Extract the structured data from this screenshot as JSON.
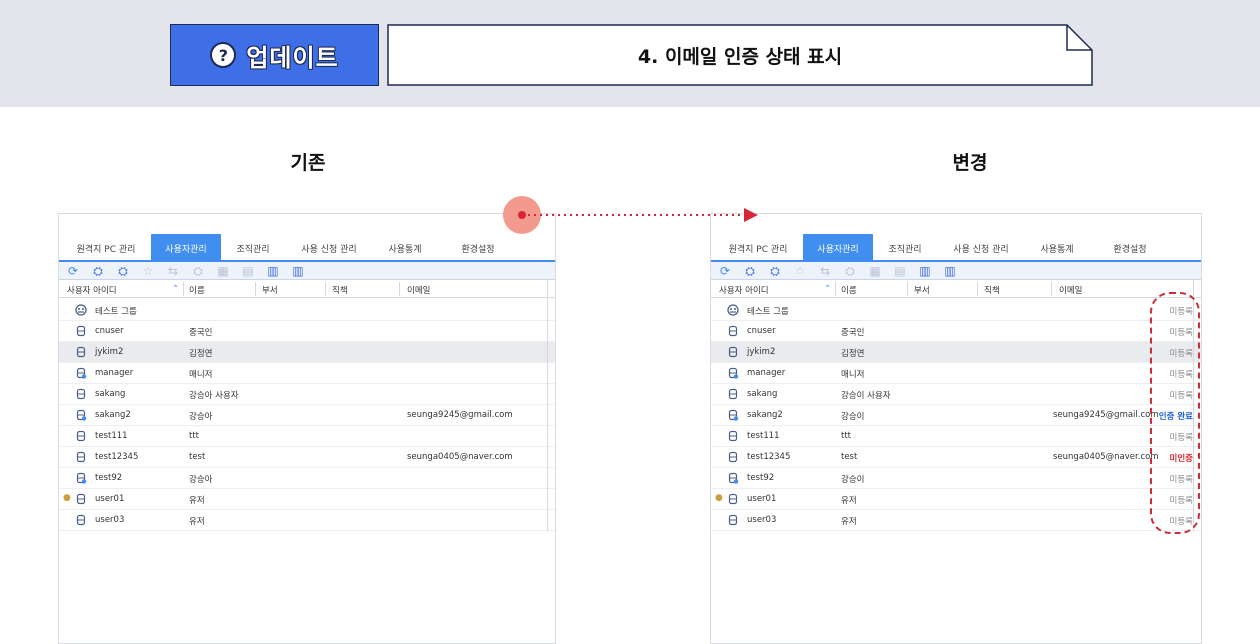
{
  "banner": {
    "badge_label": "업데이트",
    "badge_icon": "question-chat-icon",
    "title": "4. 이메일 인증 상태 표시"
  },
  "columns": {
    "before_title": "기존",
    "after_title": "변경"
  },
  "app": {
    "tabs": [
      "원격지 PC 관리",
      "사용자관리",
      "조직관리",
      "사용 신청 관리",
      "사용통계",
      "환경설정"
    ],
    "active_tab": "사용자관리",
    "toolbar_icons": [
      "refresh-icon",
      "add-group-icon",
      "add-user-icon",
      "star-icon",
      "move-icon",
      "user-icon",
      "delete-icon",
      "save-icon",
      "export-icon",
      "import-icon"
    ],
    "headers": {
      "user_id": "사용자 아이디",
      "name": "이름",
      "dept": "부서",
      "position": "직책",
      "email": "이메일"
    },
    "group_row": "테스트 그룹",
    "users": [
      {
        "id": "cnuser",
        "name": "중국인",
        "email": "",
        "status": "미등록"
      },
      {
        "id": "jykim2",
        "name": "김정연",
        "email": "",
        "status": "미등록"
      },
      {
        "id": "manager",
        "name": "매니저",
        "email": "",
        "status": "미등록"
      },
      {
        "id": "sakang",
        "name": "강승아 사용자",
        "email": "",
        "status": "미등록"
      },
      {
        "id": "sakang2",
        "name": "강승아",
        "email": "seunga9245@gmail.com",
        "status": "인증 완료"
      },
      {
        "id": "test111",
        "name": "ttt",
        "email": "",
        "status": "미등록"
      },
      {
        "id": "test12345",
        "name": "test",
        "email": "seunga0405@naver.com",
        "status": "미인증"
      },
      {
        "id": "test92",
        "name": "강승아",
        "email": "",
        "status": "미등록"
      },
      {
        "id": "user01",
        "name": "유저",
        "email": "",
        "status": "미등록"
      },
      {
        "id": "user03",
        "name": "유저",
        "email": "",
        "status": "미등록"
      }
    ],
    "after_users": [
      {
        "name": "중국인"
      },
      {
        "name": "김정연"
      },
      {
        "name": "매니저"
      },
      {
        "name": "강승이 사용자"
      },
      {
        "name": "강승이"
      },
      {
        "name": "ttt"
      },
      {
        "name": "test"
      },
      {
        "name": "강승이"
      },
      {
        "name": "유저"
      },
      {
        "name": "유저"
      }
    ],
    "group_status": "미등록"
  },
  "colors": {
    "accent_blue": "#3f8ef0",
    "badge_blue": "#3f6fe6",
    "status_ok": "#1a5fd6",
    "status_no": "#e02a2a",
    "highlight_red": "#c9303a"
  }
}
